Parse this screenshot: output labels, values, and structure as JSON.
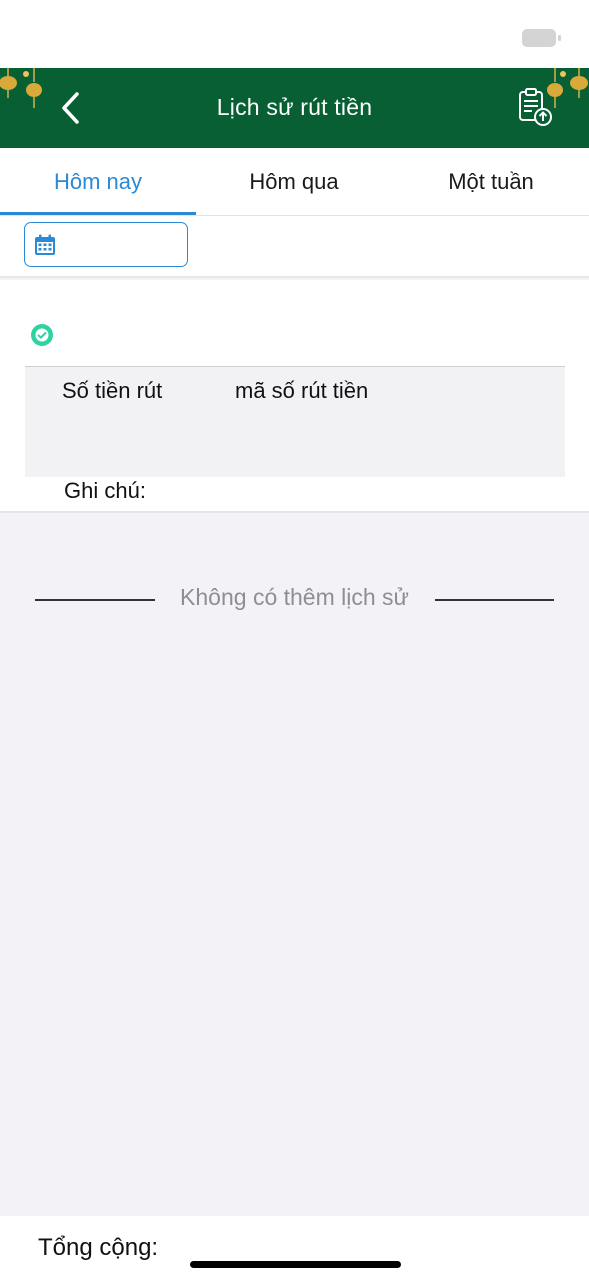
{
  "header": {
    "title": "Lịch sử rút tiền",
    "back_icon": "chevron-left-icon",
    "export_icon": "clipboard-upload-icon",
    "bar_color": "#075f33"
  },
  "tabs": [
    {
      "label": "Hôm nay",
      "active": true
    },
    {
      "label": "Hôm qua",
      "active": false
    },
    {
      "label": "Một tuần",
      "active": false
    }
  ],
  "filter": {
    "date_icon": "calendar-icon",
    "accent_color": "#2a8ad6"
  },
  "record": {
    "status_icon": "check-circle-icon",
    "amount_label": "Số tiền rút",
    "code_label": "mã số rút tiền",
    "note_label": "Ghi chú:"
  },
  "list": {
    "end_text": "Không có thêm lịch sử"
  },
  "footer": {
    "total_label": "Tổng cộng:"
  }
}
